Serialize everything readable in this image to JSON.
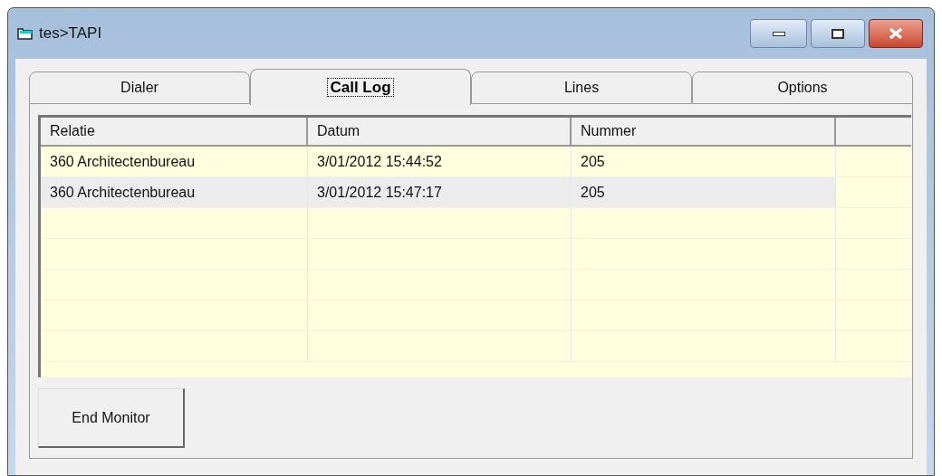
{
  "window": {
    "title": "tes>TAPI"
  },
  "tabs": [
    {
      "label": "Dialer",
      "selected": false
    },
    {
      "label": "Call Log",
      "selected": true
    },
    {
      "label": "Lines",
      "selected": false
    },
    {
      "label": "Options",
      "selected": false
    }
  ],
  "table": {
    "columns": [
      "Relatie",
      "Datum",
      "Nummer"
    ],
    "rows": [
      {
        "cells": [
          "360 Architectenbureau",
          "3/01/2012 15:44:52",
          "205"
        ],
        "selected": false
      },
      {
        "cells": [
          "360 Architectenbureau",
          "3/01/2012 15:47:17",
          "205"
        ],
        "selected": true
      }
    ]
  },
  "buttons": [
    "End Monitor"
  ]
}
